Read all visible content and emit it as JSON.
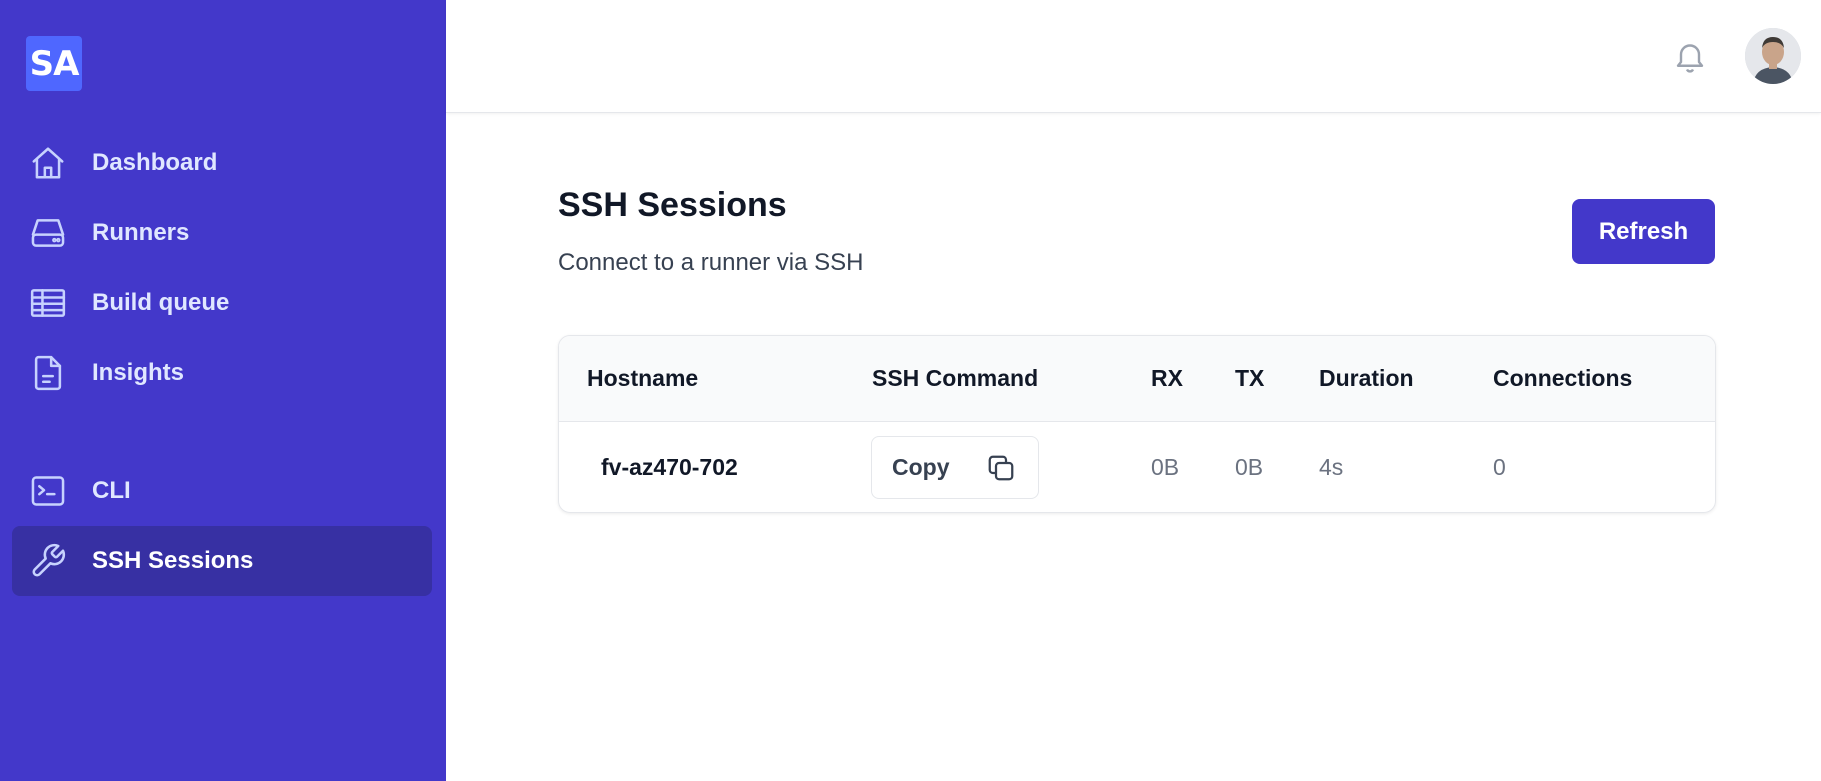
{
  "sidebar": {
    "logo_text": "SA",
    "items": [
      {
        "label": "Dashboard",
        "icon": "home-icon"
      },
      {
        "label": "Runners",
        "icon": "hard-drive-icon"
      },
      {
        "label": "Build queue",
        "icon": "table-icon"
      },
      {
        "label": "Insights",
        "icon": "document-icon"
      },
      {
        "label": "CLI",
        "icon": "terminal-icon"
      },
      {
        "label": "SSH Sessions",
        "icon": "wrench-icon",
        "active": true
      }
    ]
  },
  "header": {
    "notification_icon": "bell-icon",
    "avatar": "user-avatar"
  },
  "main": {
    "title": "SSH Sessions",
    "subtitle": "Connect to a runner via SSH",
    "refresh_label": "Refresh"
  },
  "table": {
    "columns": [
      "Hostname",
      "SSH Command",
      "RX",
      "TX",
      "Duration",
      "Connections"
    ],
    "rows": [
      {
        "hostname": "fv-az470-702",
        "command_label": "Copy",
        "rx": "0B",
        "tx": "0B",
        "duration": "4s",
        "connections": "0"
      }
    ]
  },
  "colors": {
    "sidebar_bg": "#4338ca",
    "active_item_bg": "#3730a3",
    "accent": "#4338ca",
    "logo_bg": "#4f67ff"
  }
}
